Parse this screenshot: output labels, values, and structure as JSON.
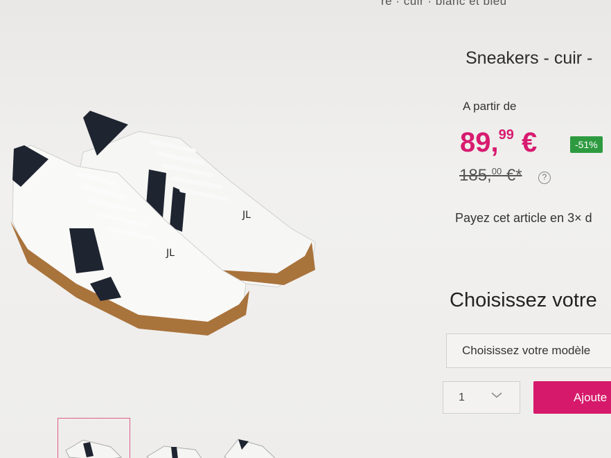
{
  "breadcrumb": "re · cuir · blanc et bleu",
  "product": {
    "title": "Sneakers - cuir -",
    "from_label": "A partir de",
    "price_main": "89,",
    "price_cents": "99",
    "price_currency": " €",
    "discount": "-51%",
    "old_price_main": "185,",
    "old_price_cents": "00",
    "old_price_currency": " €*",
    "help": "?",
    "installments": "Payez cet article en 3× d"
  },
  "options": {
    "heading": "Choisissez votre",
    "model_select": "Choisissez votre modèle",
    "qty_value": "1",
    "add_button": "Ajoute"
  },
  "colors": {
    "accent": "#d6196a",
    "badge": "#2e9a40"
  },
  "icons": {
    "help": "question-circle-icon",
    "chevron": "chevron-down-icon"
  }
}
